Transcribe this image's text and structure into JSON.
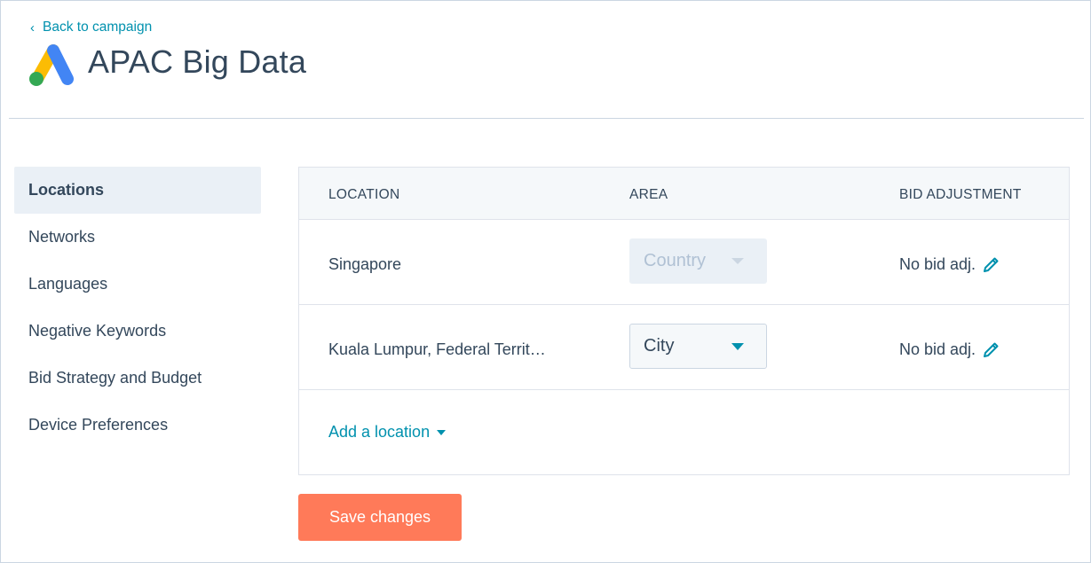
{
  "header": {
    "back_label": "Back to campaign",
    "title": "APAC Big Data"
  },
  "sidebar": {
    "items": [
      {
        "label": "Locations",
        "active": true
      },
      {
        "label": "Networks"
      },
      {
        "label": "Languages"
      },
      {
        "label": "Negative Keywords"
      },
      {
        "label": "Bid Strategy and Budget"
      },
      {
        "label": "Device Preferences"
      }
    ]
  },
  "table": {
    "columns": [
      "LOCATION",
      "AREA",
      "BID ADJUSTMENT"
    ],
    "rows": [
      {
        "location": "Singapore",
        "area": "Country",
        "area_disabled": true,
        "bid": "No bid adj."
      },
      {
        "location": "Kuala Lumpur, Federal Territ…",
        "area": "City",
        "area_disabled": false,
        "bid": "No bid adj."
      }
    ],
    "add_location_label": "Add a location"
  },
  "actions": {
    "save_label": "Save changes"
  },
  "colors": {
    "accent": "#0091ae",
    "primary_button": "#ff7a59",
    "text": "#33475b",
    "active_bg": "#eaf0f6"
  },
  "icons": {
    "back": "chevron-left-icon",
    "logo": "google-ads-logo",
    "edit": "pencil-icon",
    "dropdown": "caret-down-icon"
  }
}
